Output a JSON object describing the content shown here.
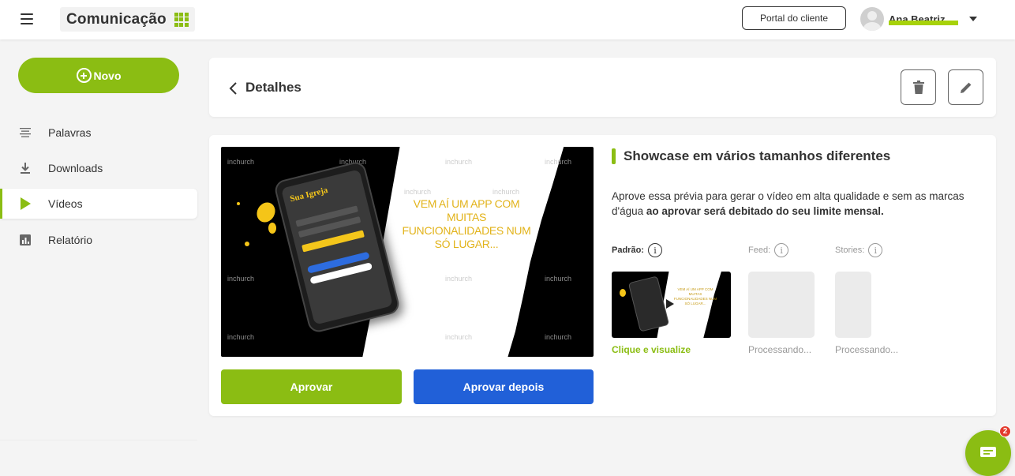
{
  "header": {
    "app_title": "Comunicação",
    "portal_label": "Portal do cliente",
    "user_name": "Ana Beatriz"
  },
  "sidebar": {
    "new_label": "Novo",
    "items": [
      {
        "label": "Palavras",
        "icon": "text-lines-icon",
        "active": false
      },
      {
        "label": "Downloads",
        "icon": "download-icon",
        "active": false
      },
      {
        "label": "Vídeos",
        "icon": "play-icon",
        "active": true
      },
      {
        "label": "Relatório",
        "icon": "bar-chart-icon",
        "active": false
      }
    ]
  },
  "details": {
    "title": "Detalhes",
    "delete_icon": "trash-icon",
    "edit_icon": "pencil-icon"
  },
  "preview": {
    "headline": "VEM AÍ UM APP COM MUITAS FUNCIONALIDADES NUM SÓ LUGAR...",
    "phone_title": "Sua Igreja",
    "watermark": "inchurch"
  },
  "actions": {
    "approve_label": "Aprovar",
    "approve_later_label": "Aprovar depois"
  },
  "showcase": {
    "title": "Showcase em vários tamanhos diferentes",
    "description_plain": "Aprove essa prévia para gerar o vídeo em alta qualidade e sem as marcas d'água ",
    "description_bold": "ao aprovar será debitado do seu limite mensal.",
    "formats": {
      "standard_label": "Padrão:",
      "feed_label": "Feed:",
      "stories_label": "Stories:",
      "info_glyph": "i",
      "standard_caption": "Clique e visualize",
      "feed_caption": "Processando...",
      "stories_caption": "Processando..."
    }
  },
  "chat": {
    "badge_count": "2"
  },
  "colors": {
    "accent": "#8bbd13",
    "primary_blue": "#2160d8",
    "badge": "#e33b2e"
  }
}
